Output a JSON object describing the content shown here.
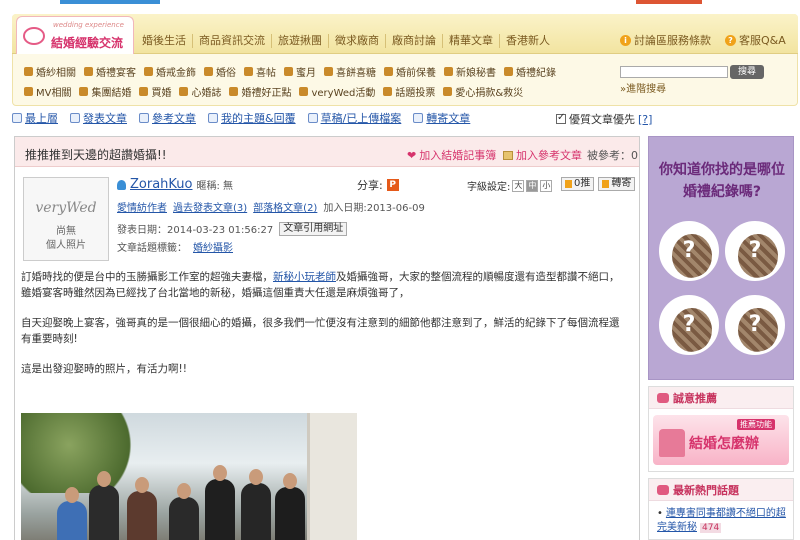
{
  "site": {
    "logo_sub": "wedding experience",
    "logo_name": "結婚經驗交流"
  },
  "nav": {
    "tabs": [
      "婚後生活",
      "商品資訊交流",
      "旅遊揪團",
      "徵求廠商",
      "廠商討論",
      "精華文章",
      "香港新人"
    ],
    "right": [
      {
        "icon": "i",
        "label": "討論區服務條款"
      },
      {
        "icon": "?",
        "label": "客服Q&A"
      }
    ]
  },
  "categories": {
    "row1": [
      "婚紗相關",
      "婚禮宴客",
      "婚戒金飾",
      "婚俗",
      "喜帖",
      "蜜月",
      "喜餅喜糖",
      "婚前保養",
      "新娘秘書",
      "婚禮紀錄"
    ],
    "row2": [
      "MV相關",
      "集團結婚",
      "買婚",
      "心婚誌",
      "婚禮好正點",
      "veryWed活動",
      "話題投票",
      "愛心捐款&救災"
    ]
  },
  "search": {
    "placeholder": "",
    "button": "搜尋",
    "advanced": "»進階搜尋"
  },
  "actions": [
    "最上層",
    "發表文章",
    "參考文章",
    "我的主題&回覆",
    "草稿/已上傳檔案",
    "轉寄文章"
  ],
  "quality": {
    "label": "優質文章優先",
    "help": "[?]",
    "checked": true
  },
  "post": {
    "title": "推推推到天邊的超讚婚攝!!",
    "add_wedding": "加入結婚記事簿",
    "add_ref": "加入參考文章",
    "ref_count": "被參考：0",
    "avatar_logo": "veryWed",
    "avatar_l1": "尚無",
    "avatar_l2": "個人照片",
    "username": "ZorahKuo",
    "nickname": "暱稱: 無",
    "share": "分享:",
    "share_icon": "P",
    "font_label": "字級設定:",
    "font_sizes": [
      "大",
      "中",
      "小"
    ],
    "like": "0推",
    "mail": "轉寄",
    "meta_links": [
      "愛情紡作者",
      "過去發表文章(3)",
      "部落格文章(2)"
    ],
    "join_date": "加入日期:2013-06-09",
    "post_date": "發表日期：2014-03-23 01:56:27",
    "quote_btn": "文章引用網址",
    "category_label": "文章話題標籤：",
    "category_value": "婚紗攝影",
    "para1_pre": "訂婚時找的便是台中的玉勝攝影工作室的超強夫妻檔，",
    "para1_link": "新秘小玩老師",
    "para1_post": "及婚攝強哥，大家的整個流程的順暢度還有造型都讚不絕口，雖婚宴客時雖然因為已經找了台北當地的新秘，婚攝這個重責大任還是麻煩強哥了，",
    "para2": "自天迎娶晚上宴客，強哥真的是一個很細心的婚攝，很多我們一忙便沒有注意到的細節他都注意到了，鮮活的紀錄下了每個流程還有重要時刻!",
    "para3": "這是出發迎娶時的照片，有活力啊!!"
  },
  "sidebar": {
    "quiz_l1": "你知道你找的是哪位",
    "quiz_l2": "婚禮紀錄嗎?",
    "recommend_title": "誠意推薦",
    "banner_tag": "推薦功能",
    "banner_text": "結婚怎麼辦",
    "hot_title": "最新熱門話題",
    "hot_item": "連專害同事都讚不絕口的超完美新秘",
    "hot_count": "474"
  },
  "colors": {
    "accent": "#d6336c",
    "link": "#2456a8",
    "nav_bg": "#f2e4a0",
    "quiz_bg": "#b9a7d3"
  }
}
